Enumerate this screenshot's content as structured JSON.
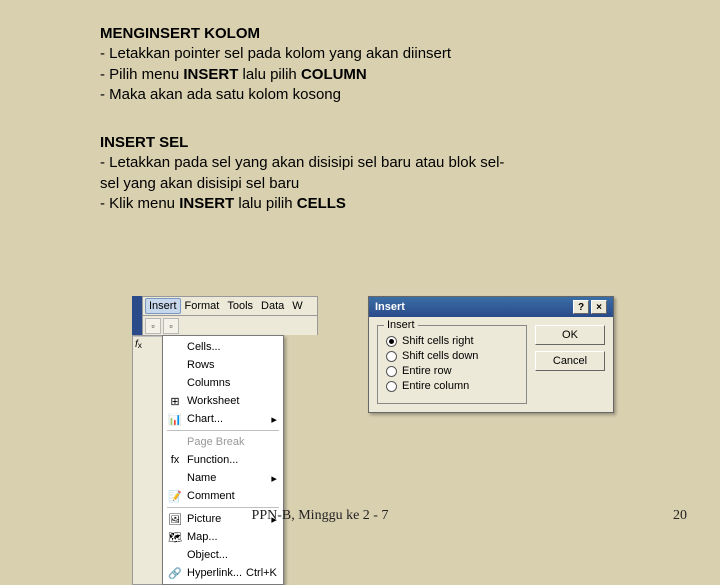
{
  "section1": {
    "heading": "MENGINSERT KOLOM",
    "lines": [
      "- Letakkan pointer sel pada kolom yang akan diinsert",
      {
        "pre": "- Pilih menu ",
        "b1": "INSERT",
        "mid": " lalu pilih ",
        "b2": "COLUMN"
      },
      "- Maka akan ada satu kolom kosong"
    ]
  },
  "section2": {
    "heading": "INSERT SEL",
    "lines": [
      "- Letakkan pada sel yang akan disisipi sel baru atau blok sel-",
      "  sel yang akan disisipi sel baru",
      {
        "pre": "- Klik menu ",
        "b1": "INSERT",
        "mid": " lalu pilih ",
        "b2": "CELLS"
      }
    ]
  },
  "menu": {
    "bar": [
      "Insert",
      "Format",
      "Tools",
      "Data",
      "W"
    ],
    "items": [
      {
        "icon": "",
        "label": "Cells..."
      },
      {
        "icon": "",
        "label": "Rows"
      },
      {
        "icon": "",
        "label": "Columns"
      },
      {
        "icon": "⊞",
        "label": "Worksheet"
      },
      {
        "icon": "📊",
        "label": "Chart...",
        "arrow": true
      },
      "sep",
      {
        "icon": "",
        "label": "Page Break",
        "disabled": true
      },
      {
        "icon": "fx",
        "label": "Function..."
      },
      {
        "icon": "",
        "label": "Name",
        "arrow": true
      },
      {
        "icon": "📝",
        "label": "Comment"
      },
      "sep",
      {
        "icon": "🖼",
        "label": "Picture",
        "arrow": true
      },
      {
        "icon": "🗺",
        "label": "Map..."
      },
      {
        "icon": "",
        "label": "Object..."
      },
      {
        "icon": "🔗",
        "label": "Hyperlink...",
        "shortcut": "Ctrl+K"
      }
    ]
  },
  "dialog": {
    "title": "Insert",
    "group": "Insert",
    "options": [
      {
        "label": "Shift cells right",
        "checked": true
      },
      {
        "label": "Shift cells down",
        "checked": false
      },
      {
        "label": "Entire row",
        "checked": false
      },
      {
        "label": "Entire column",
        "checked": false
      }
    ],
    "buttons": {
      "ok": "OK",
      "cancel": "Cancel"
    },
    "help": "?",
    "close": "×"
  },
  "footer": {
    "center": "PPN-B, Minggu ke 2 - 7",
    "page": "20"
  }
}
